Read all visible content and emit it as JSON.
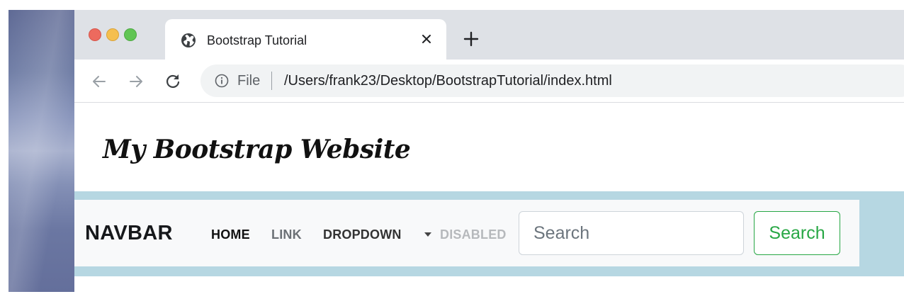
{
  "browser": {
    "tab": {
      "title": "Bootstrap Tutorial",
      "favicon": "globe-icon",
      "close_glyph": "✕"
    },
    "new_tab_icon": "plus-icon",
    "toolbar": {
      "back_icon": "arrow-left-icon",
      "forward_icon": "arrow-right-icon",
      "reload_icon": "reload-icon"
    },
    "omnibox": {
      "info_icon": "info-icon",
      "scheme_label": "File",
      "url": "/Users/frank23/Desktop/BootstrapTutorial/index.html"
    }
  },
  "page": {
    "site_title": "My Bootstrap Website",
    "navbar": {
      "brand": "NAVBAR",
      "links": {
        "home": "HOME",
        "link": "LINK",
        "dropdown": "DROPDOWN",
        "disabled": "DISABLED"
      },
      "search": {
        "placeholder": "Search",
        "button_label": "Search"
      }
    }
  },
  "colors": {
    "tabstrip": "#dee1e6",
    "nav_band": "#b6d7e2",
    "navbar_bg": "#f8f9fa",
    "success_green": "#28a745",
    "traffic_red": "#ed6a5e",
    "traffic_yellow": "#f5bf4f",
    "traffic_green": "#61c554"
  }
}
